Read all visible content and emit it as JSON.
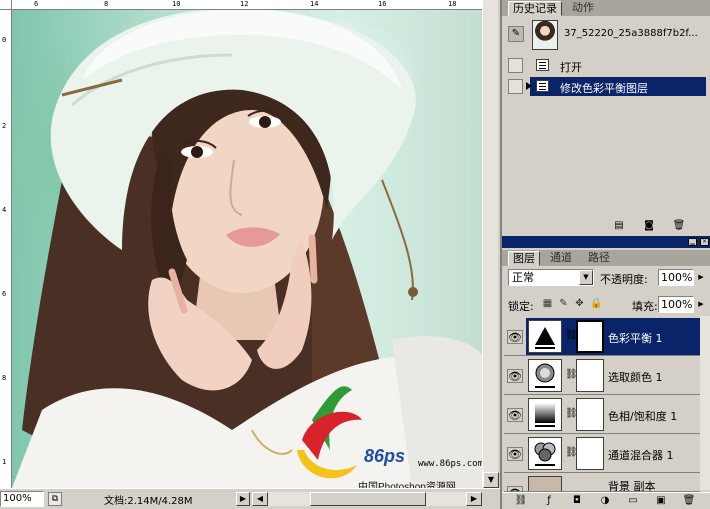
{
  "window": {
    "ruler_top_numbers": [
      "6",
      "8",
      "10",
      "12",
      "14",
      "16",
      "18"
    ],
    "ruler_left_numbers": [
      "0",
      "2",
      "4",
      "6",
      "8",
      "1"
    ],
    "zoom": "100%",
    "doc_size": "文档:2.14M/4.28M"
  },
  "watermark": {
    "brand": "86ps",
    "site": "www.86ps.com",
    "caption": "中国Photoshop资源网"
  },
  "history_panel": {
    "tabs": [
      "历史记录",
      "动作"
    ],
    "snapshot_name": "37_52220_25a3888f7b2f...",
    "items": [
      {
        "label": "打开",
        "selected": false
      },
      {
        "label": "修改色彩平衡图层",
        "selected": true
      }
    ],
    "bottom_icons": [
      "new-document-icon",
      "camera-icon",
      "trash-icon"
    ]
  },
  "layers_panel": {
    "tabs": [
      "图层",
      "通道",
      "路径"
    ],
    "blend_mode": "正常",
    "opacity_label": "不透明度:",
    "opacity_value": "100%",
    "lock_label": "锁定:",
    "fill_label": "填充:",
    "fill_value": "100%",
    "layers": [
      {
        "name": "色彩平衡 1",
        "icon": "color-balance-icon",
        "selected": true
      },
      {
        "name": "选取颜色 1",
        "icon": "selective-color-icon",
        "selected": false
      },
      {
        "name": "色相/饱和度 1",
        "icon": "hue-saturation-icon",
        "selected": false
      },
      {
        "name": "通道混合器 1",
        "icon": "channel-mixer-icon",
        "selected": false
      },
      {
        "name": "背景 副本",
        "icon": "image-icon",
        "selected": false
      }
    ],
    "bottom_icons": [
      "link-icon",
      "fx-icon",
      "mask-icon",
      "adjustment-icon",
      "folder-icon",
      "new-layer-icon",
      "trash-icon"
    ]
  },
  "colors": {
    "selection": "#0a246a",
    "panel": "#d4d0c8",
    "tabbar": "#a9a59c"
  }
}
